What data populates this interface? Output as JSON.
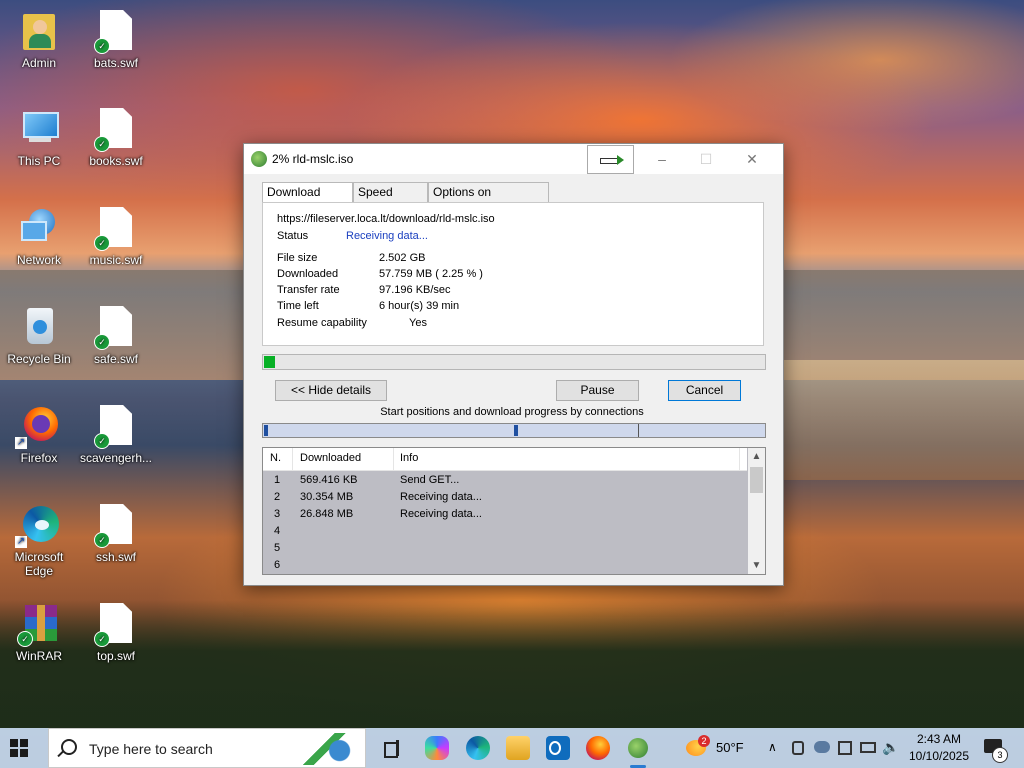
{
  "desktop": {
    "icons": [
      {
        "label": "Admin"
      },
      {
        "label": "bats.swf"
      },
      {
        "label": "This PC"
      },
      {
        "label": "books.swf"
      },
      {
        "label": "Network"
      },
      {
        "label": "music.swf"
      },
      {
        "label": "Recycle Bin"
      },
      {
        "label": "safe.swf"
      },
      {
        "label": "Firefox"
      },
      {
        "label": "scavengerh..."
      },
      {
        "label": "Microsoft Edge"
      },
      {
        "label": "ssh.swf"
      },
      {
        "label": "WinRAR"
      },
      {
        "label": "top.swf"
      }
    ]
  },
  "window": {
    "title": "2% rld-mslc.iso",
    "minimize_icon": "–",
    "maximize_icon": "☐",
    "close_icon": "✕",
    "tabs": [
      "Download status",
      "Speed Limiter",
      "Options on completion"
    ],
    "url": "https://fileserver.loca.lt/download/rld-mslc.iso",
    "fields": {
      "status_label": "Status",
      "status_value": "Receiving data...",
      "file_size_label": "File size",
      "file_size_value": "2.502  GB",
      "downloaded_label": "Downloaded",
      "downloaded_value": "57.759  MB  ( 2.25 % )",
      "transfer_rate_label": "Transfer rate",
      "transfer_rate_value": "97.196  KB/sec",
      "time_left_label": "Time left",
      "time_left_value": "6 hour(s) 39 min",
      "resume_label": "Resume capability",
      "resume_value": "Yes"
    },
    "progress_percent": 2.25,
    "buttons": {
      "hide_details": "<< Hide details",
      "pause": "Pause",
      "cancel": "Cancel"
    },
    "connections_caption": "Start positions and download progress by connections",
    "connections": {
      "headers": [
        "N.",
        "Downloaded",
        "Info"
      ],
      "rows": [
        {
          "n": "1",
          "downloaded": "569.416  KB",
          "info": "Send GET..."
        },
        {
          "n": "2",
          "downloaded": "30.354  MB",
          "info": "Receiving data..."
        },
        {
          "n": "3",
          "downloaded": "26.848  MB",
          "info": "Receiving data..."
        },
        {
          "n": "4",
          "downloaded": "",
          "info": ""
        },
        {
          "n": "5",
          "downloaded": "",
          "info": ""
        },
        {
          "n": "6",
          "downloaded": "",
          "info": ""
        }
      ]
    }
  },
  "taskbar": {
    "search_placeholder": "Type here to search",
    "weather_temp": "50°F",
    "weather_badge": "2",
    "time": "2:43 AM",
    "date": "10/10/2025",
    "notification_count": "3",
    "accent_color": "#2a7bd1"
  }
}
